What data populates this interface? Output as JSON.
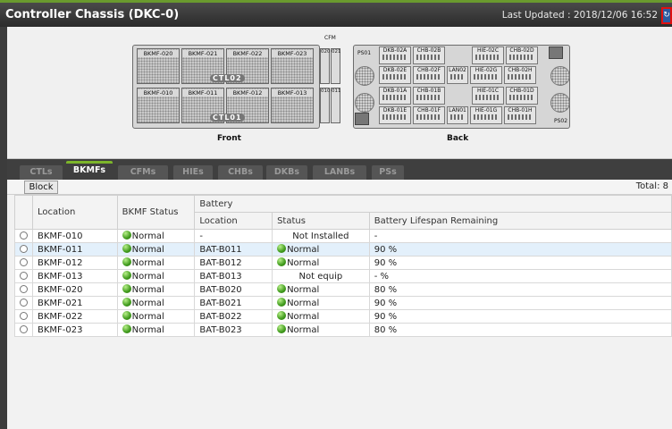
{
  "header": {
    "title": "Controller Chassis (DKC-0)",
    "last_updated": "Last Updated : 2018/12/06 16:52",
    "refresh_icon": "refresh-icon",
    "accent_color": "#7cb52a"
  },
  "chassis": {
    "front": {
      "caption": "Front",
      "cfm_label": "CFM",
      "top_slots": [
        "BKMF-020",
        "BKMF-021",
        "BKMF-022",
        "BKMF-023"
      ],
      "bottom_slots": [
        "BKMF-010",
        "BKMF-011",
        "BKMF-012",
        "BKMF-013"
      ],
      "top_cfms": [
        "020",
        "021"
      ],
      "bottom_cfms": [
        "010",
        "011"
      ],
      "ctl_top": "CTL02",
      "ctl_bottom": "CTL01"
    },
    "back": {
      "caption": "Back",
      "ps_top": "PS01",
      "ps_bottom": "PS02",
      "rows": [
        [
          "DKB-02A",
          "CHB-02B",
          "HIE-02C",
          "CHB-02D"
        ],
        [
          "DKB-02E",
          "CHB-02F",
          "LAN02",
          "HIE-02G",
          "CHB-02H"
        ],
        [
          "DKB-01A",
          "CHB-01B",
          "HIE-01C",
          "CHB-01D"
        ],
        [
          "DKB-01E",
          "CHB-01F",
          "LAN01",
          "HIE-01G",
          "CHB-01H"
        ]
      ]
    }
  },
  "tabs": [
    "CTLs",
    "BKMFs",
    "CFMs",
    "HIEs",
    "CHBs",
    "DKBs",
    "LANBs",
    "PSs"
  ],
  "active_tab": "BKMFs",
  "toolbar": {
    "block_label": "Block",
    "total": "Total: 8"
  },
  "table": {
    "group_header": "Battery",
    "columns": [
      "Location",
      "BKMF Status",
      "Location",
      "Status",
      "Battery Lifespan Remaining"
    ],
    "rows": [
      {
        "location": "BKMF-010",
        "status": "Normal",
        "bat_location": "-",
        "bat_status": "Not Installed",
        "bat_status_icon": false,
        "lifespan": "-"
      },
      {
        "location": "BKMF-011",
        "status": "Normal",
        "bat_location": "BAT-B011",
        "bat_status": "Normal",
        "bat_status_icon": true,
        "lifespan": "90 %"
      },
      {
        "location": "BKMF-012",
        "status": "Normal",
        "bat_location": "BAT-B012",
        "bat_status": "Normal",
        "bat_status_icon": true,
        "lifespan": "90 %"
      },
      {
        "location": "BKMF-013",
        "status": "Normal",
        "bat_location": "BAT-B013",
        "bat_status": "Not equip",
        "bat_status_icon": false,
        "lifespan": "- %"
      },
      {
        "location": "BKMF-020",
        "status": "Normal",
        "bat_location": "BAT-B020",
        "bat_status": "Normal",
        "bat_status_icon": true,
        "lifespan": "80 %"
      },
      {
        "location": "BKMF-021",
        "status": "Normal",
        "bat_location": "BAT-B021",
        "bat_status": "Normal",
        "bat_status_icon": true,
        "lifespan": "90 %"
      },
      {
        "location": "BKMF-022",
        "status": "Normal",
        "bat_location": "BAT-B022",
        "bat_status": "Normal",
        "bat_status_icon": true,
        "lifespan": "90 %"
      },
      {
        "location": "BKMF-023",
        "status": "Normal",
        "bat_location": "BAT-B023",
        "bat_status": "Normal",
        "bat_status_icon": true,
        "lifespan": "80 %"
      }
    ]
  }
}
